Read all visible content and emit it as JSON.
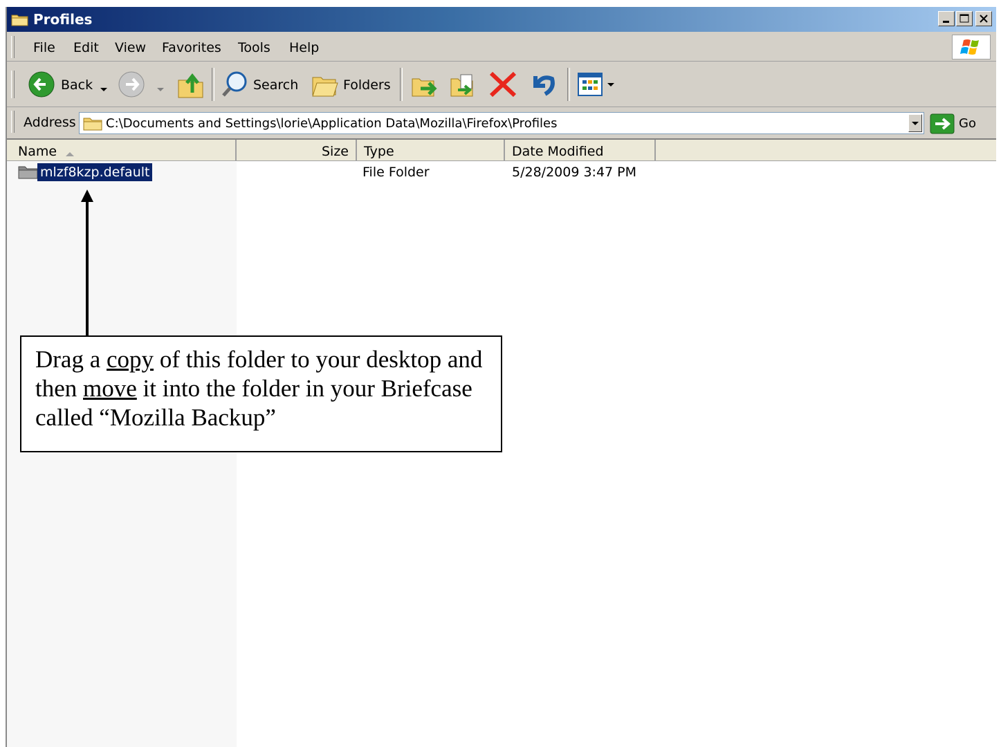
{
  "window": {
    "title": "Profiles"
  },
  "menu": {
    "items": [
      "File",
      "Edit",
      "View",
      "Favorites",
      "Tools",
      "Help"
    ]
  },
  "toolbar": {
    "back_label": "Back",
    "search_label": "Search",
    "folders_label": "Folders"
  },
  "address": {
    "label": "Address",
    "value": "C:\\Documents and Settings\\lorie\\Application Data\\Mozilla\\Firefox\\Profiles",
    "go_label": "Go"
  },
  "list": {
    "columns": [
      "Name",
      "Size",
      "Type",
      "Date Modified"
    ],
    "rows": [
      {
        "name": "mlzf8kzp.default",
        "size": "",
        "type": "File Folder",
        "date": "5/28/2009 3:47 PM"
      }
    ]
  },
  "callout": {
    "part1": "Drag a ",
    "copy": "copy",
    "part2": " of this folder to your desktop and then ",
    "move": "move",
    "part3": " it into the folder in your Briefcase called “Mozilla Backup”"
  },
  "colors": {
    "title_gradient_start": "#0a246a",
    "selection": "#0a246a",
    "chrome": "#d4d0c8"
  }
}
